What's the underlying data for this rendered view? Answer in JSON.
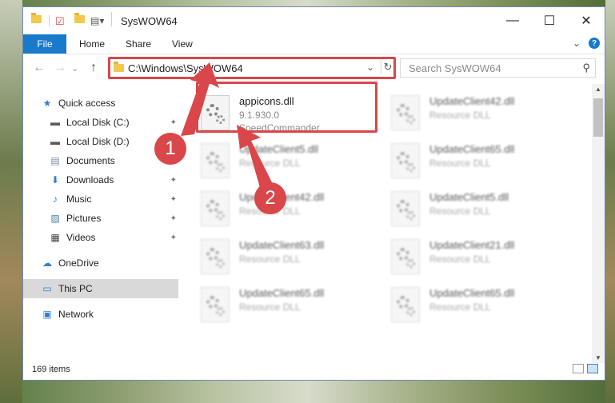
{
  "window": {
    "title": "SysWOW64",
    "controls": {
      "minimize": "—",
      "maximize": "☐",
      "close": "✕"
    }
  },
  "ribbon": {
    "tabs": [
      "File",
      "Home",
      "Share",
      "View"
    ],
    "expand_glyph": "⌄",
    "help_glyph": "?"
  },
  "navbar": {
    "back": "←",
    "forward": "→",
    "recent": "⌄",
    "up": "↑",
    "address": "C:\\Windows\\SysWOW64",
    "address_dropdown": "⌄",
    "refresh": "↻",
    "search_placeholder": "Search SysWOW64"
  },
  "sidebar": {
    "items": [
      {
        "label": "Quick access",
        "icon": "star-icon",
        "glyph": "★",
        "color": "#2f7fd1",
        "pinned": false
      },
      {
        "label": "Local Disk (C:)",
        "icon": "drive-icon",
        "glyph": "▬",
        "color": "#5a5a5a",
        "pinned": true
      },
      {
        "label": "Local Disk (D:)",
        "icon": "drive-icon",
        "glyph": "▬",
        "color": "#5a5a5a",
        "pinned": true
      },
      {
        "label": "Documents",
        "icon": "documents-icon",
        "glyph": "▤",
        "color": "#7a8aa0",
        "pinned": true
      },
      {
        "label": "Downloads",
        "icon": "download-icon",
        "glyph": "⬇",
        "color": "#2f7fd1",
        "pinned": true
      },
      {
        "label": "Music",
        "icon": "music-icon",
        "glyph": "♪",
        "color": "#2f7fd1",
        "pinned": true
      },
      {
        "label": "Pictures",
        "icon": "pictures-icon",
        "glyph": "▨",
        "color": "#4a7fb0",
        "pinned": true
      },
      {
        "label": "Videos",
        "icon": "video-icon",
        "glyph": "▦",
        "color": "#444444",
        "pinned": true
      },
      {
        "label": "OneDrive",
        "icon": "cloud-icon",
        "glyph": "☁",
        "color": "#2f7fd1",
        "pinned": false
      },
      {
        "label": "This PC",
        "icon": "computer-icon",
        "glyph": "▭",
        "color": "#2f7fd1",
        "pinned": false
      },
      {
        "label": "Network",
        "icon": "network-icon",
        "glyph": "▣",
        "color": "#2f7fd1",
        "pinned": false
      }
    ],
    "pin_glyph": "📌"
  },
  "files": [
    {
      "name": "appicons.dll",
      "line2": "9.1.930.0",
      "line3": "SpeedCommander",
      "blurred": false
    },
    {
      "name": "UpdateClient42.dll",
      "line2": "Resource DLL",
      "line3": "",
      "blurred": true
    },
    {
      "name": "UpdateClient5.dll",
      "line2": "Resource DLL",
      "line3": "",
      "blurred": true
    },
    {
      "name": "UpdateClient65.dll",
      "line2": "Resource DLL",
      "line3": "",
      "blurred": true
    },
    {
      "name": "UpdateClient42.dll",
      "line2": "Resource DLL",
      "line3": "",
      "blurred": true
    },
    {
      "name": "UpdateClient5.dll",
      "line2": "Resource DLL",
      "line3": "",
      "blurred": true
    },
    {
      "name": "UpdateClient63.dll",
      "line2": "Resource DLL",
      "line3": "",
      "blurred": true
    },
    {
      "name": "UpdateClient21.dll",
      "line2": "Resource DLL",
      "line3": "",
      "blurred": true
    },
    {
      "name": "UpdateClient65.dll",
      "line2": "Resource DLL",
      "line3": "",
      "blurred": true
    },
    {
      "name": "UpdateClient65.dll",
      "line2": "Resource DLL",
      "line3": "",
      "blurred": true
    }
  ],
  "status": {
    "item_count": "169 items"
  },
  "annotations": {
    "badge1": "1",
    "badge2": "2",
    "color": "#d9474a"
  }
}
